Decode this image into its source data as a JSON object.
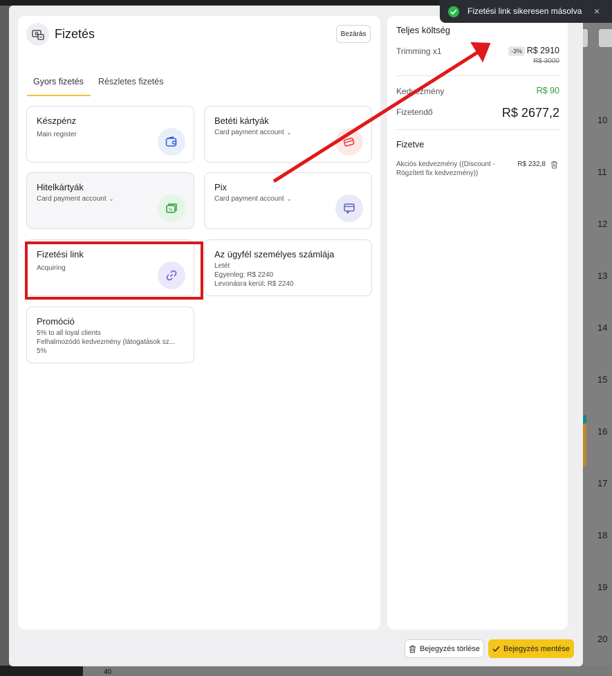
{
  "toast": {
    "message": "Fizetési link sikeresen másolva",
    "close_glyph": "×",
    "icon": "check-circle-icon"
  },
  "modal": {
    "title": "Fizetés",
    "close_label": "Bezárás",
    "tabs": [
      {
        "label": "Gyors fizetés",
        "active": true
      },
      {
        "label": "Részletes fizetés",
        "active": false
      }
    ],
    "methods": [
      {
        "title": "Készpénz",
        "lines": [
          "Main register"
        ],
        "dropdown": false,
        "icon": "wallet-icon"
      },
      {
        "title": "Betéti kártyák",
        "lines": [
          "Card payment account"
        ],
        "dropdown": true,
        "icon": "card-icon"
      },
      {
        "title": "Hitelkártyák",
        "lines": [
          "Card payment account"
        ],
        "dropdown": true,
        "icon": "credit-card-icon"
      },
      {
        "title": "Pix",
        "lines": [
          "Card payment account"
        ],
        "dropdown": true,
        "icon": "pix-icon"
      },
      {
        "title": "Fizetési link",
        "lines": [
          "Acquiring"
        ],
        "dropdown": false,
        "icon": "link-icon"
      },
      {
        "title": "Az ügyfél személyes számlája",
        "lines": [
          "Letét",
          "Egyenleg: R$ 2240",
          "Levonásra kerül: R$ 2240"
        ],
        "dropdown": false,
        "icon": ""
      },
      {
        "title": "Promóció",
        "lines": [
          "5% to all loyal clients",
          "Felhalmozódó kedvezmény (látogatások sz...",
          "5%"
        ],
        "dropdown": false,
        "icon": ""
      }
    ]
  },
  "summary": {
    "title": "Teljes költség",
    "item_name": "Trimming  x1",
    "discount_badge": "-3%",
    "item_price": "R$ 2910",
    "item_old_price": "R$ 3000",
    "discount_label": "Kedvezmény",
    "discount_value": "R$ 90",
    "payable_label": "Fizetendő",
    "payable_value": "R$ 2677,2",
    "paid_title": "Fizetve",
    "paid_item_desc": "Akciós kedvezmény ((Discount - Rögzített fix kedvezmény))",
    "paid_item_amount": "R$ 232,8"
  },
  "footer": {
    "delete_label": "Bejegyzés törlése",
    "save_label": "Bejegyzés mentése"
  },
  "background": {
    "calendar_hours": [
      "10",
      "11",
      "12",
      "13",
      "14",
      "15",
      "16",
      "17",
      "18",
      "19",
      "20"
    ],
    "bottom_number": "40"
  },
  "colors": {
    "accent_yellow": "#f5c518",
    "highlight_red": "#d9191c",
    "discount_green": "#2a9d3b",
    "toast_bg": "#2a2d34"
  }
}
